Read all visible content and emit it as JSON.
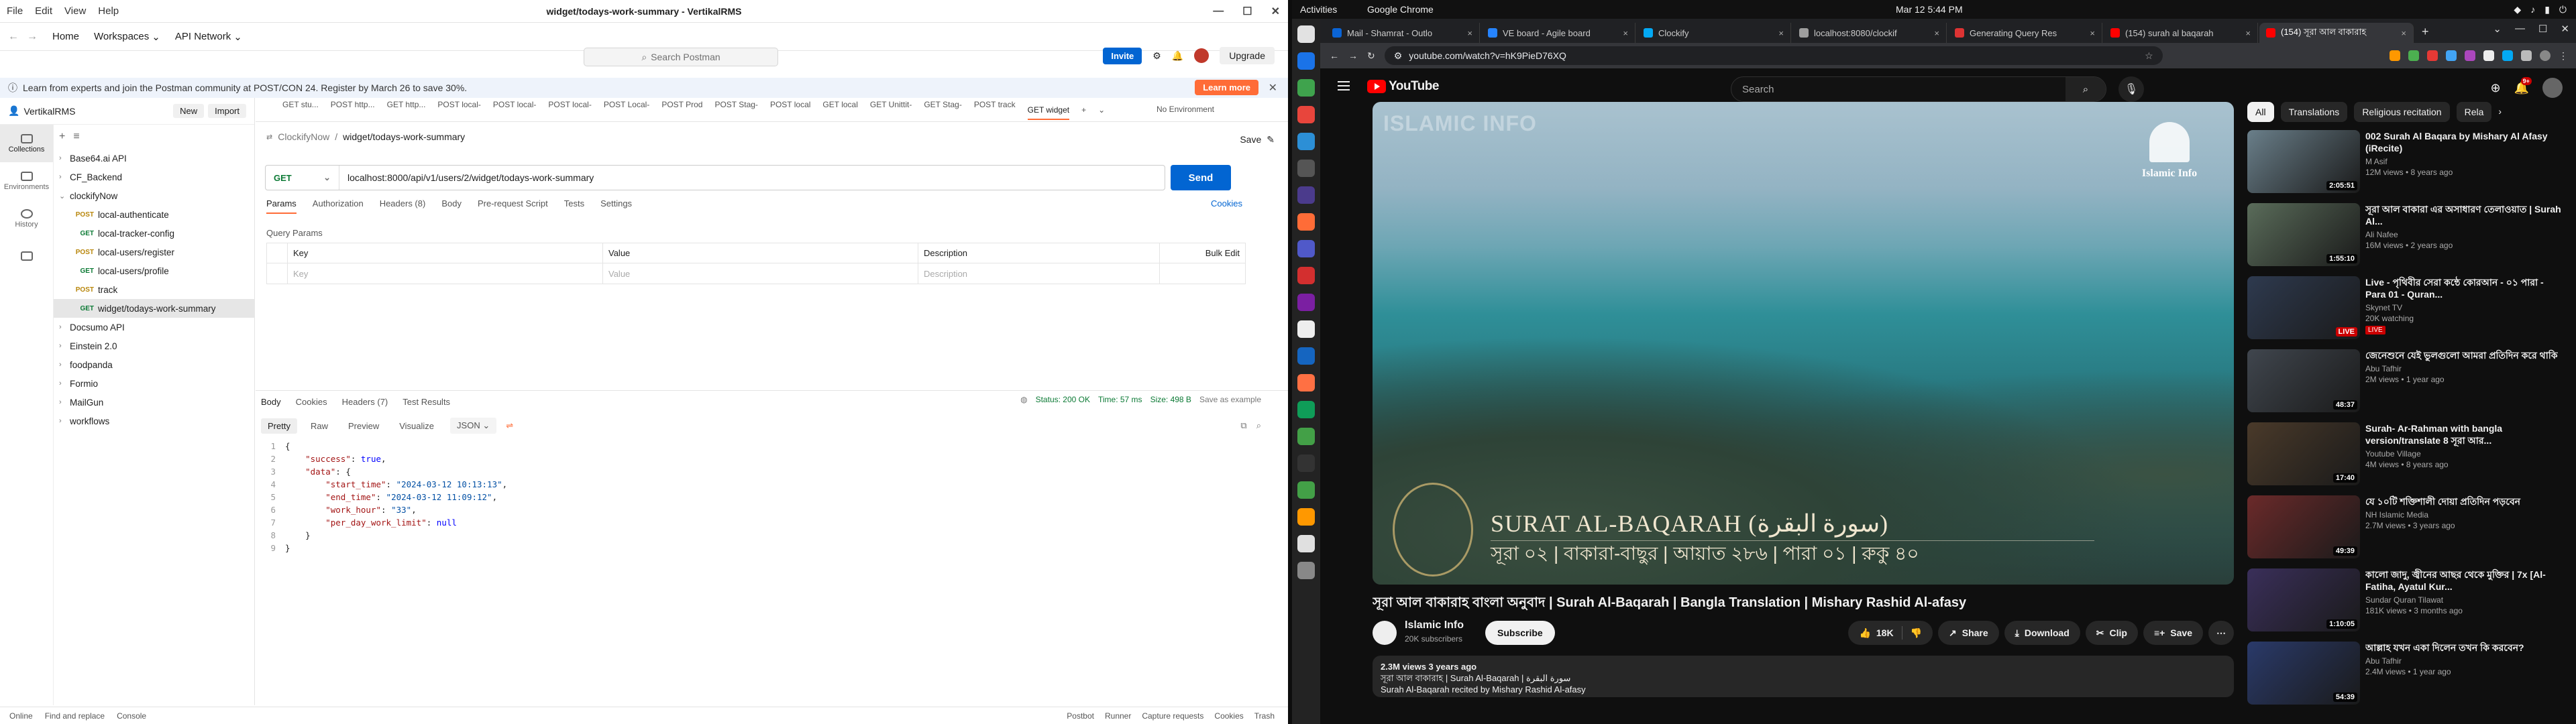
{
  "postman": {
    "window_title": "widget/todays-work-summary - VertikalRMS",
    "menu": [
      "File",
      "Edit",
      "View",
      "Help"
    ],
    "topbar": {
      "home": "Home",
      "workspaces": "Workspaces",
      "api_network": "API Network",
      "search_placeholder": "Search Postman",
      "invite": "Invite",
      "upgrade": "Upgrade"
    },
    "banner": {
      "text": "Learn from experts and join the Postman community at POST/CON 24. Register by March 26 to save 30%.",
      "button": "Learn more"
    },
    "workspace": {
      "name": "VertikalRMS",
      "new": "New",
      "import": "Import"
    },
    "rail": [
      "Collections",
      "Environments",
      "History"
    ],
    "tree": [
      {
        "label": "Base64.ai API",
        "type": "folder",
        "depth": 0
      },
      {
        "label": "CF_Backend",
        "type": "folder",
        "depth": 0
      },
      {
        "label": "clockifyNow",
        "type": "folder-open",
        "depth": 0
      },
      {
        "label": "local-authenticate",
        "type": "POST",
        "depth": 1
      },
      {
        "label": "local-tracker-config",
        "type": "GET",
        "depth": 1
      },
      {
        "label": "local-users/register",
        "type": "POST",
        "depth": 1
      },
      {
        "label": "local-users/profile",
        "type": "GET",
        "depth": 1
      },
      {
        "label": "track",
        "type": "POST",
        "depth": 1
      },
      {
        "label": "widget/todays-work-summary",
        "type": "GET",
        "depth": 1,
        "selected": true
      },
      {
        "label": "Docsumo API",
        "type": "folder",
        "depth": 0
      },
      {
        "label": "Einstein 2.0",
        "type": "folder",
        "depth": 0
      },
      {
        "label": "foodpanda",
        "type": "folder",
        "depth": 0
      },
      {
        "label": "Formio",
        "type": "folder",
        "depth": 0
      },
      {
        "label": "MailGun",
        "type": "folder",
        "depth": 0
      },
      {
        "label": "workflows",
        "type": "folder",
        "depth": 0
      }
    ],
    "tabs": [
      "GET stu...",
      "POST http...",
      "GET http...",
      "POST local-",
      "POST local-",
      "POST local-",
      "POST Local-",
      "POST Prod",
      "POST Stag-",
      "POST local",
      "GET local",
      "GET Unittit-",
      "GET Stag-",
      "POST track",
      "GET widget"
    ],
    "env": "No Environment",
    "breadcrumb": {
      "collection": "ClockifyNow",
      "request": "widget/todays-work-summary"
    },
    "save": "Save",
    "request": {
      "method": "GET",
      "url": "localhost:8000/api/v1/users/2/widget/todays-work-summary",
      "send": "Send"
    },
    "req_tabs": [
      "Params",
      "Authorization",
      "Headers (8)",
      "Body",
      "Pre-request Script",
      "Tests",
      "Settings"
    ],
    "cookies": "Cookies",
    "query_params_label": "Query Params",
    "qp_headers": [
      "Key",
      "Value",
      "Description",
      "Bulk Edit"
    ],
    "qp_placeholder": [
      "Key",
      "Value",
      "Description"
    ],
    "resp_tabs": [
      "Body",
      "Cookies",
      "Headers (7)",
      "Test Results"
    ],
    "resp_status": {
      "status": "Status: 200 OK",
      "time": "Time: 57 ms",
      "size": "Size: 498 B",
      "save": "Save as example"
    },
    "fmt_tabs": [
      "Pretty",
      "Raw",
      "Preview",
      "Visualize"
    ],
    "fmt": "JSON",
    "code_lines": [
      {
        "n": "1",
        "t": "{"
      },
      {
        "n": "2",
        "t": "    \"success\": true,"
      },
      {
        "n": "3",
        "t": "    \"data\": {"
      },
      {
        "n": "4",
        "t": "        \"start_time\": \"2024-03-12 10:13:13\","
      },
      {
        "n": "5",
        "t": "        \"end_time\": \"2024-03-12 11:09:12\","
      },
      {
        "n": "6",
        "t": "        \"work_hour\": \"33\","
      },
      {
        "n": "7",
        "t": "        \"per_day_work_limit\": null"
      },
      {
        "n": "8",
        "t": "    }"
      },
      {
        "n": "9",
        "t": "}"
      }
    ],
    "status_bar": [
      "Online",
      "Find and replace",
      "Console"
    ],
    "status_bar_right": [
      "Postbot",
      "Runner",
      "Capture requests",
      "Cookies",
      "Trash"
    ]
  },
  "gnome": {
    "activities": "Activities",
    "app": "Google Chrome",
    "clock": "Mar 12  5:44 PM"
  },
  "chrome": {
    "tabs": [
      {
        "label": "Mail - Shamrat - Outlo",
        "color": "#0a64d6"
      },
      {
        "label": "VE board - Agile board",
        "color": "#2684ff"
      },
      {
        "label": "Clockify",
        "color": "#03a9f4"
      },
      {
        "label": "localhost:8080/clockif",
        "color": "#9e9e9e"
      },
      {
        "label": "Generating Query Res",
        "color": "#d33"
      },
      {
        "label": "(154) surah al baqarah",
        "color": "#ff0000"
      },
      {
        "label": "(154) সূরা আল বাকারাহ",
        "color": "#ff0000",
        "active": true
      }
    ],
    "url": "youtube.com/watch?v=hK9PieD76XQ"
  },
  "youtube": {
    "logo": "YouTube",
    "search_placeholder": "Search",
    "notif_count": "9+",
    "player": {
      "watermark": "ISLAMIC INFO",
      "channel_logo": "Islamic Info",
      "overlay_en": "SURAT AL-BAQARAH (سورة البقرة)",
      "overlay_bn": "সূরা ০২ | বাকারা-বাছুর | আয়াত ২৮৬ | পারা ০১ | রুকু ৪০"
    },
    "title": "সূরা আল বাকারাহ বাংলা অনুবাদ | Surah Al-Baqarah | Bangla Translation | Mishary Rashid Al-afasy",
    "channel": "Islamic Info",
    "subs": "20K subscribers",
    "subscribe": "Subscribe",
    "actions": [
      "18K",
      "Share",
      "Download",
      "Clip",
      "Save"
    ],
    "desc_stats": "2.3M views  3 years ago",
    "desc_line1": "সূরা আল বাকারাহ | Surah Al-Baqarah | سورة البقرة",
    "desc_line2": "Surah Al-Baqarah recited by Mishary Rashid Al-afasy",
    "chips": [
      "All",
      "Translations",
      "Religious recitation",
      "Rela"
    ],
    "recs": [
      {
        "title": "002 Surah Al Baqara by Mishary Al Afasy (iRecite)",
        "channel": "M Asif",
        "views": "12M views • 8 years ago",
        "dur": "2:05:51",
        "thumb": "#6a7f8a"
      },
      {
        "title": "সূরা আল বাকারা এর অসাধারণ তেলাওয়াত | Surah Al...",
        "channel": "Ali Nafee",
        "views": "16M views • 2 years ago",
        "dur": "1:55:10",
        "thumb": "#5a6c5a"
      },
      {
        "title": "Live - পৃথিবীর সেরা কন্ঠে কোরআন - ০১ পারা - Para 01 - Quran...",
        "channel": "Skynet TV",
        "views": "20K watching",
        "dur": "LIVE",
        "thumb": "#2e3a4f",
        "badge": "LIVE"
      },
      {
        "title": "জেনেশুনে যেই ভুলগুলো আমরা প্রতিদিন করে থাকি",
        "channel": "Abu Tafhir",
        "views": "2M views • 1 year ago",
        "dur": "48:37",
        "thumb": "#40464e"
      },
      {
        "title": "Surah- Ar-Rahman with bangla version/translate 8 সূরা আর...",
        "channel": "Youtube Village",
        "views": "4M views • 8 years ago",
        "dur": "17:40",
        "thumb": "#4a3a2a"
      },
      {
        "title": "যে ১০টি শক্তিশালী দোয়া প্রতিদিন পড়বেন",
        "channel": "NH Islamic Media",
        "views": "2.7M views • 3 years ago",
        "dur": "49:39",
        "thumb": "#6b2a2a"
      },
      {
        "title": "কালো জাদু, জ্বীনের আছর থেকে মুক্তির | 7x [Al-Fatiha, Ayatul Kur...",
        "channel": "Sundar Quran Tilawat",
        "views": "181K views • 3 months ago",
        "dur": "1:10:05",
        "thumb": "#3a2f5a"
      },
      {
        "title": "আল্লাহ যখন একা দিলেন তখন কি করবেন?",
        "channel": "Abu Tafhir",
        "views": "2.4M views • 1 year ago",
        "dur": "54:39",
        "thumb": "#2a3a6a"
      }
    ]
  }
}
